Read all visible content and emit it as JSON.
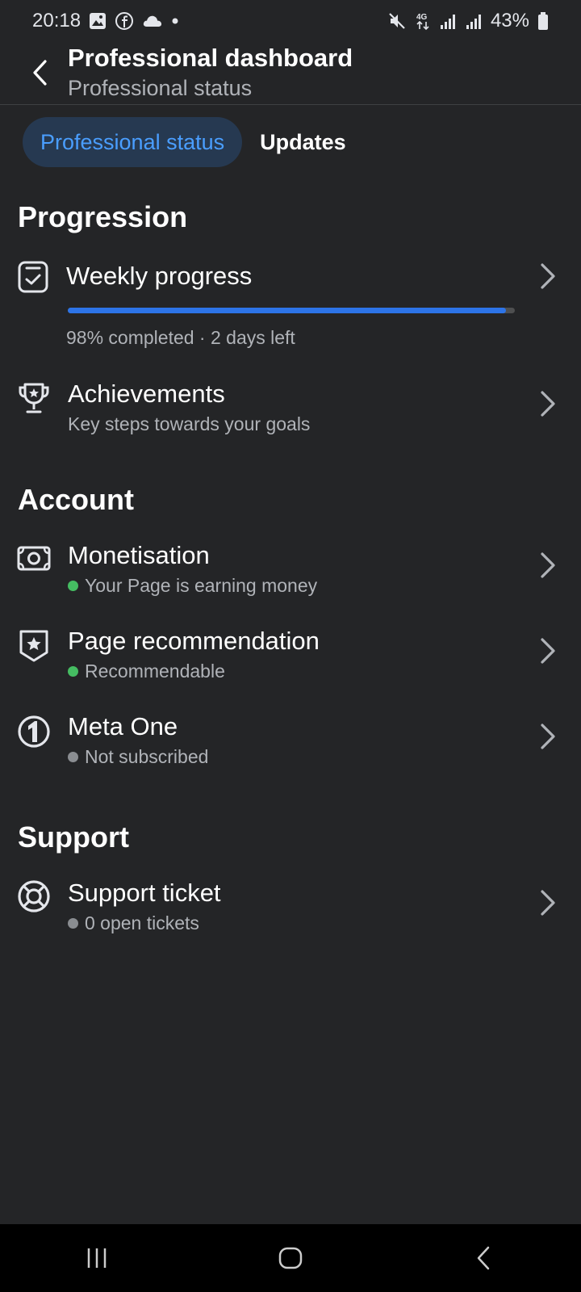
{
  "status_bar": {
    "time": "20:18",
    "left_icons": [
      "gallery-icon",
      "facebook-icon",
      "cloud-icon",
      "dot-icon"
    ],
    "right_icons": [
      "mute-icon",
      "4g-icon",
      "signal-icon",
      "signal-icon"
    ],
    "battery": "43%"
  },
  "header": {
    "title": "Professional dashboard",
    "subtitle": "Professional status"
  },
  "tabs": [
    {
      "label": "Professional status",
      "active": true
    },
    {
      "label": "Updates",
      "active": false
    }
  ],
  "sections": {
    "progression": {
      "title": "Progression",
      "weekly": {
        "title": "Weekly progress",
        "progress": 0.98,
        "caption": "98% completed · 2 days left",
        "icon": "checklist-icon"
      },
      "achievements": {
        "title": "Achievements",
        "subtitle": "Key steps towards your goals",
        "icon": "trophy-icon"
      }
    },
    "account": {
      "title": "Account",
      "items": [
        {
          "title": "Monetisation",
          "status": "Your Page is earning money",
          "status_color": "#45bd62",
          "icon": "money-icon"
        },
        {
          "title": "Page recommendation",
          "status": "Recommendable",
          "status_color": "#45bd62",
          "icon": "badge-star-icon"
        },
        {
          "title": "Meta One",
          "status": "Not subscribed",
          "status_color": "#8a8d91",
          "icon": "meta-one-icon"
        }
      ]
    },
    "support": {
      "title": "Support",
      "ticket": {
        "title": "Support ticket",
        "status": "0 open tickets",
        "status_color": "#8a8d91",
        "icon": "lifebuoy-icon"
      }
    }
  },
  "colors": {
    "background": "#242527",
    "accent": "#4a9eff",
    "active_tab_bg": "#263951",
    "progress_fill": "#2d74e7"
  }
}
